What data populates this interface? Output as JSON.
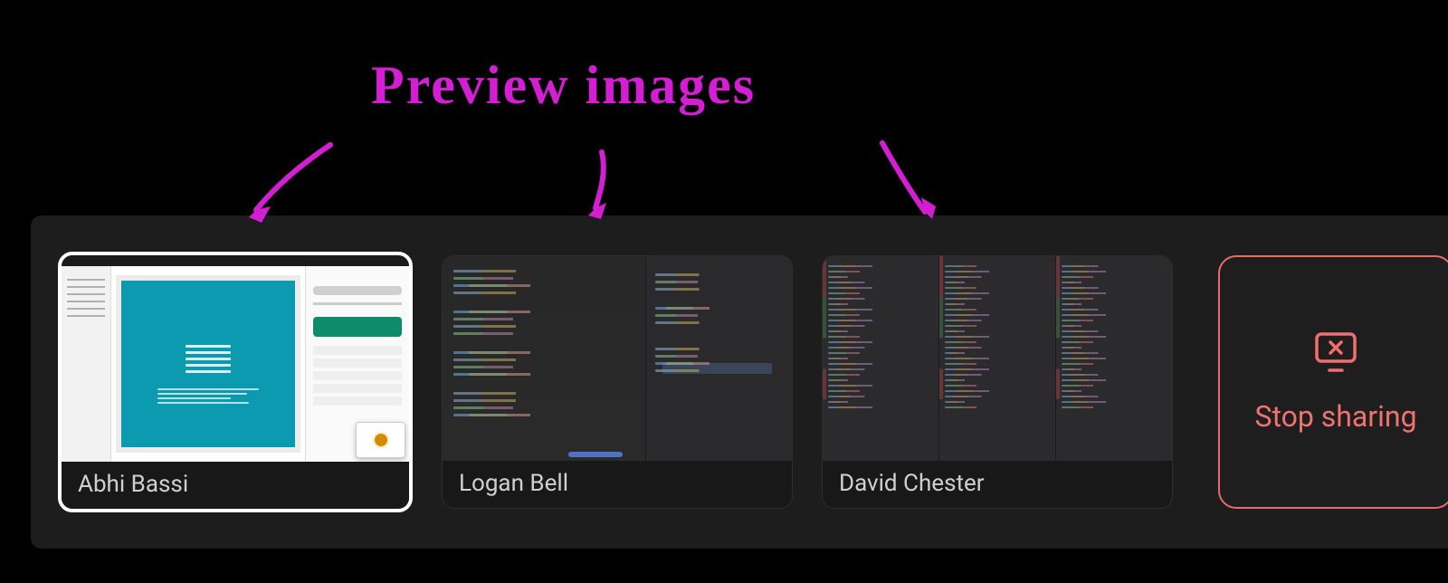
{
  "annotation": {
    "label": "Preview images"
  },
  "tiles": [
    {
      "name": "Abhi Bassi",
      "selected": true
    },
    {
      "name": "Logan Bell",
      "selected": false
    },
    {
      "name": "David Chester",
      "selected": false
    }
  ],
  "stopShare": {
    "label": "Stop sharing"
  }
}
